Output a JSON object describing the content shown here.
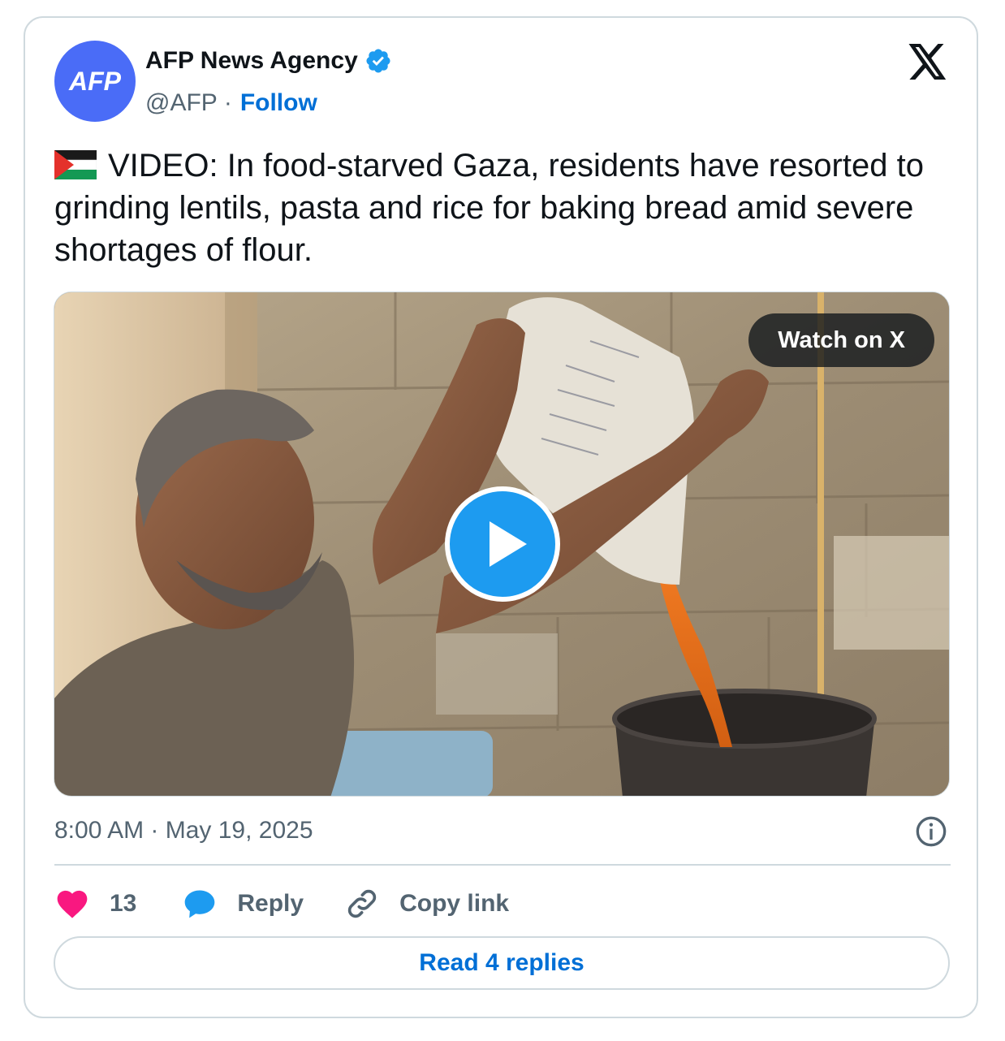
{
  "author": {
    "name": "AFP News Agency",
    "handle": "@AFP",
    "separator": "·",
    "follow_label": "Follow",
    "avatar_text": "AFP",
    "avatar_color": "#4a6cf7",
    "verified_color": "#1d9bf0"
  },
  "platform_icon": "x-logo-icon",
  "tweet": {
    "flag_icon": "palestine-flag-icon",
    "text": "VIDEO: In food-starved Gaza, residents have resorted to grinding lentils, pasta and rice for baking bread amid severe shortages of flour."
  },
  "media": {
    "watch_label": "Watch on X",
    "play_icon": "play-icon"
  },
  "timestamp": "8:00 AM · May 19, 2025",
  "info_icon": "info-icon",
  "actions": {
    "like_count": "13",
    "reply_label": "Reply",
    "copy_label": "Copy link"
  },
  "read_replies_label": "Read 4 replies",
  "colors": {
    "link": "#006fd6",
    "muted": "#536471",
    "heart": "#f91880",
    "reply_bubble": "#1d9bf0",
    "border": "#cfd9de"
  }
}
